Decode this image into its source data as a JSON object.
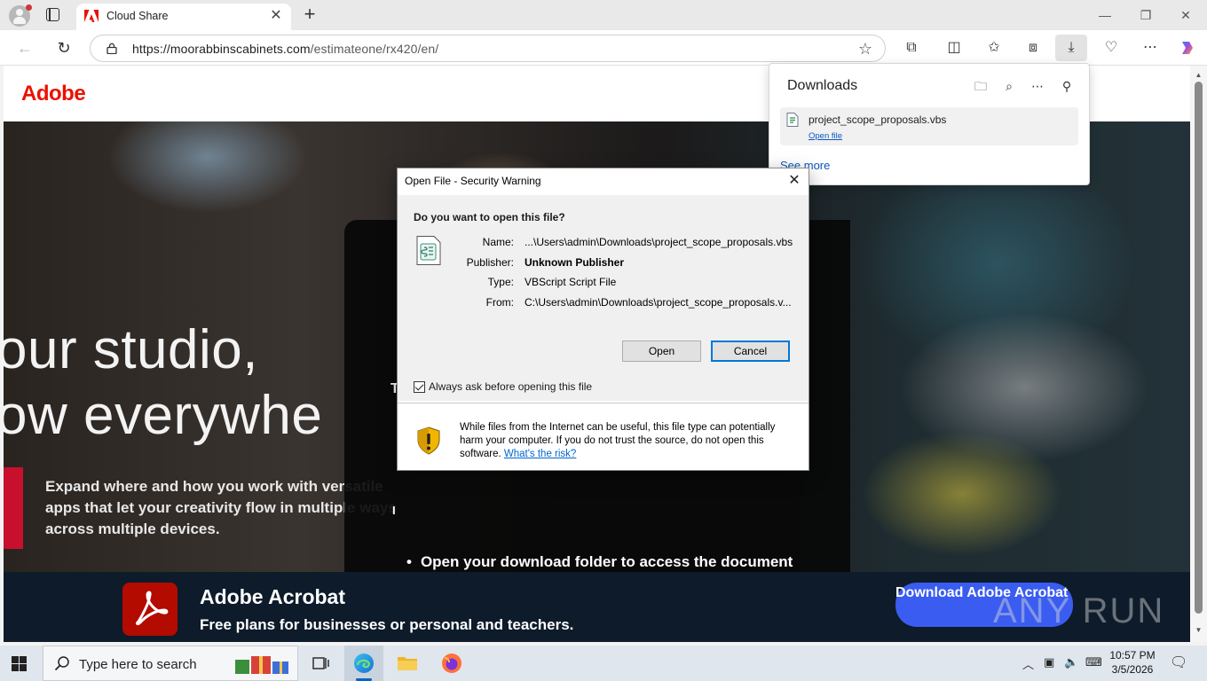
{
  "browser": {
    "tab_title": "Cloud Share",
    "url_host": "https://moorabbinscabinets.com",
    "url_path": "/estimateone/rx420/en/"
  },
  "page": {
    "logo_text": "Adobe",
    "hero_line1": "our studio,",
    "hero_line2": "ow everywhe",
    "hero_sub": "Expand where and how you work with versatile apps that let your creativity flow in multiple ways across multiple devices.",
    "panel_bullet": "Open your download folder to access the document",
    "panel_frag_t": "T",
    "panel_frag_i": "I",
    "footer_title": "Adobe Acrobat",
    "footer_sub": "Free plans for businesses or personal and teachers.",
    "download_button": "Download Adobe Acrobat",
    "watermark": "ANY RUN"
  },
  "downloads": {
    "title": "Downloads",
    "file_name": "project_scope_proposals.vbs",
    "open_link": "Open file",
    "see_more": "See more"
  },
  "dialog": {
    "title": "Open File - Security Warning",
    "question": "Do you want to open this file?",
    "name_label": "Name:",
    "name_value": "...\\Users\\admin\\Downloads\\project_scope_proposals.vbs",
    "publisher_label": "Publisher:",
    "publisher_value": "Unknown Publisher",
    "type_label": "Type:",
    "type_value": "VBScript Script File",
    "from_label": "From:",
    "from_value": "C:\\Users\\admin\\Downloads\\project_scope_proposals.v...",
    "open_button": "Open",
    "cancel_button": "Cancel",
    "checkbox_label": "Always ask before opening this file",
    "checkbox_checked": true,
    "warning_text": "While files from the Internet can be useful, this file type can potentially harm your computer. If you do not trust the source, do not open this software.",
    "risk_link": "What's the risk?"
  },
  "taskbar": {
    "search_placeholder": "Type here to search",
    "time": "10:57 PM",
    "date": "3/5/2026"
  },
  "colors": {
    "adobe_red": "#eb1000",
    "link_blue": "#0b57c2",
    "dialog_default_border": "#0078d7",
    "footer_bg": "#0d1b2a"
  }
}
